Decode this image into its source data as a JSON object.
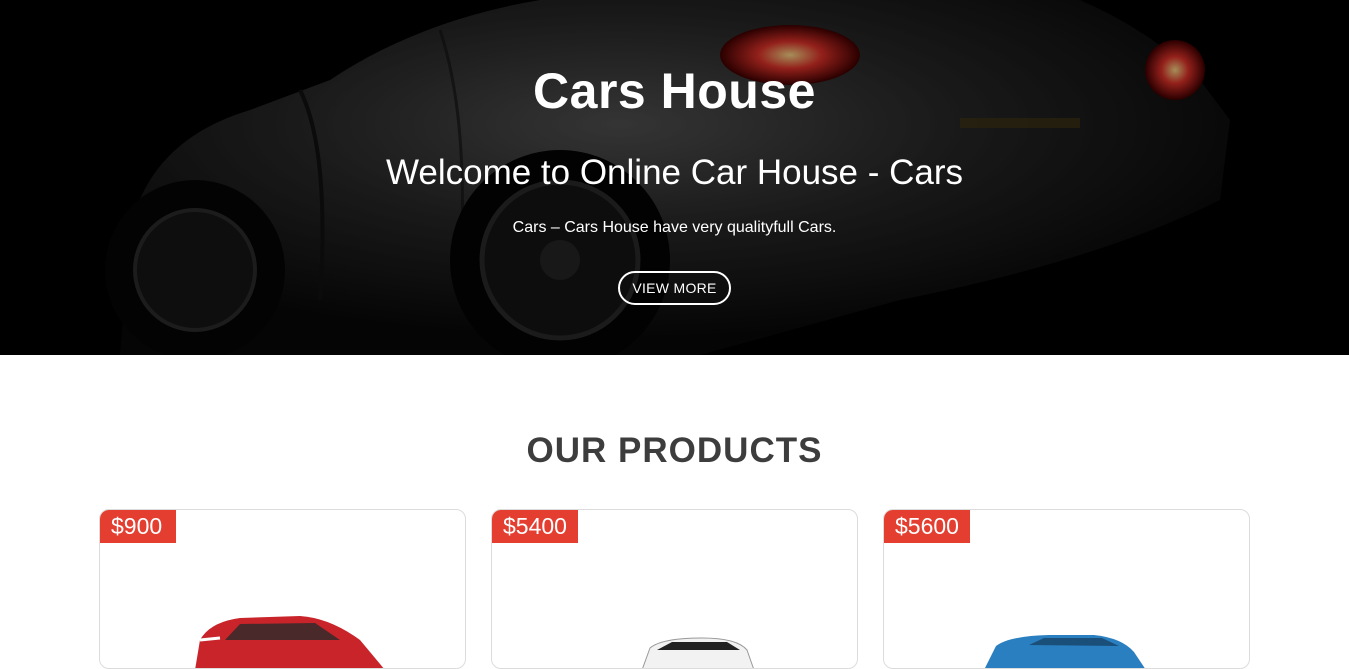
{
  "hero": {
    "title": "Cars House",
    "subtitle": "Welcome to Online Car House - Cars",
    "text": "Cars – Cars House have very qualityfull Cars.",
    "button_label": "VIEW MORE"
  },
  "products": {
    "heading": "OUR PRODUCTS",
    "items": [
      {
        "price": "$900",
        "car_color": "#c8242a"
      },
      {
        "price": "$5400",
        "car_color": "#f2f2f2"
      },
      {
        "price": "$5600",
        "car_color": "#2a7fc0"
      }
    ]
  },
  "colors": {
    "accent": "#e43e31",
    "heading": "#3d3d3d"
  }
}
